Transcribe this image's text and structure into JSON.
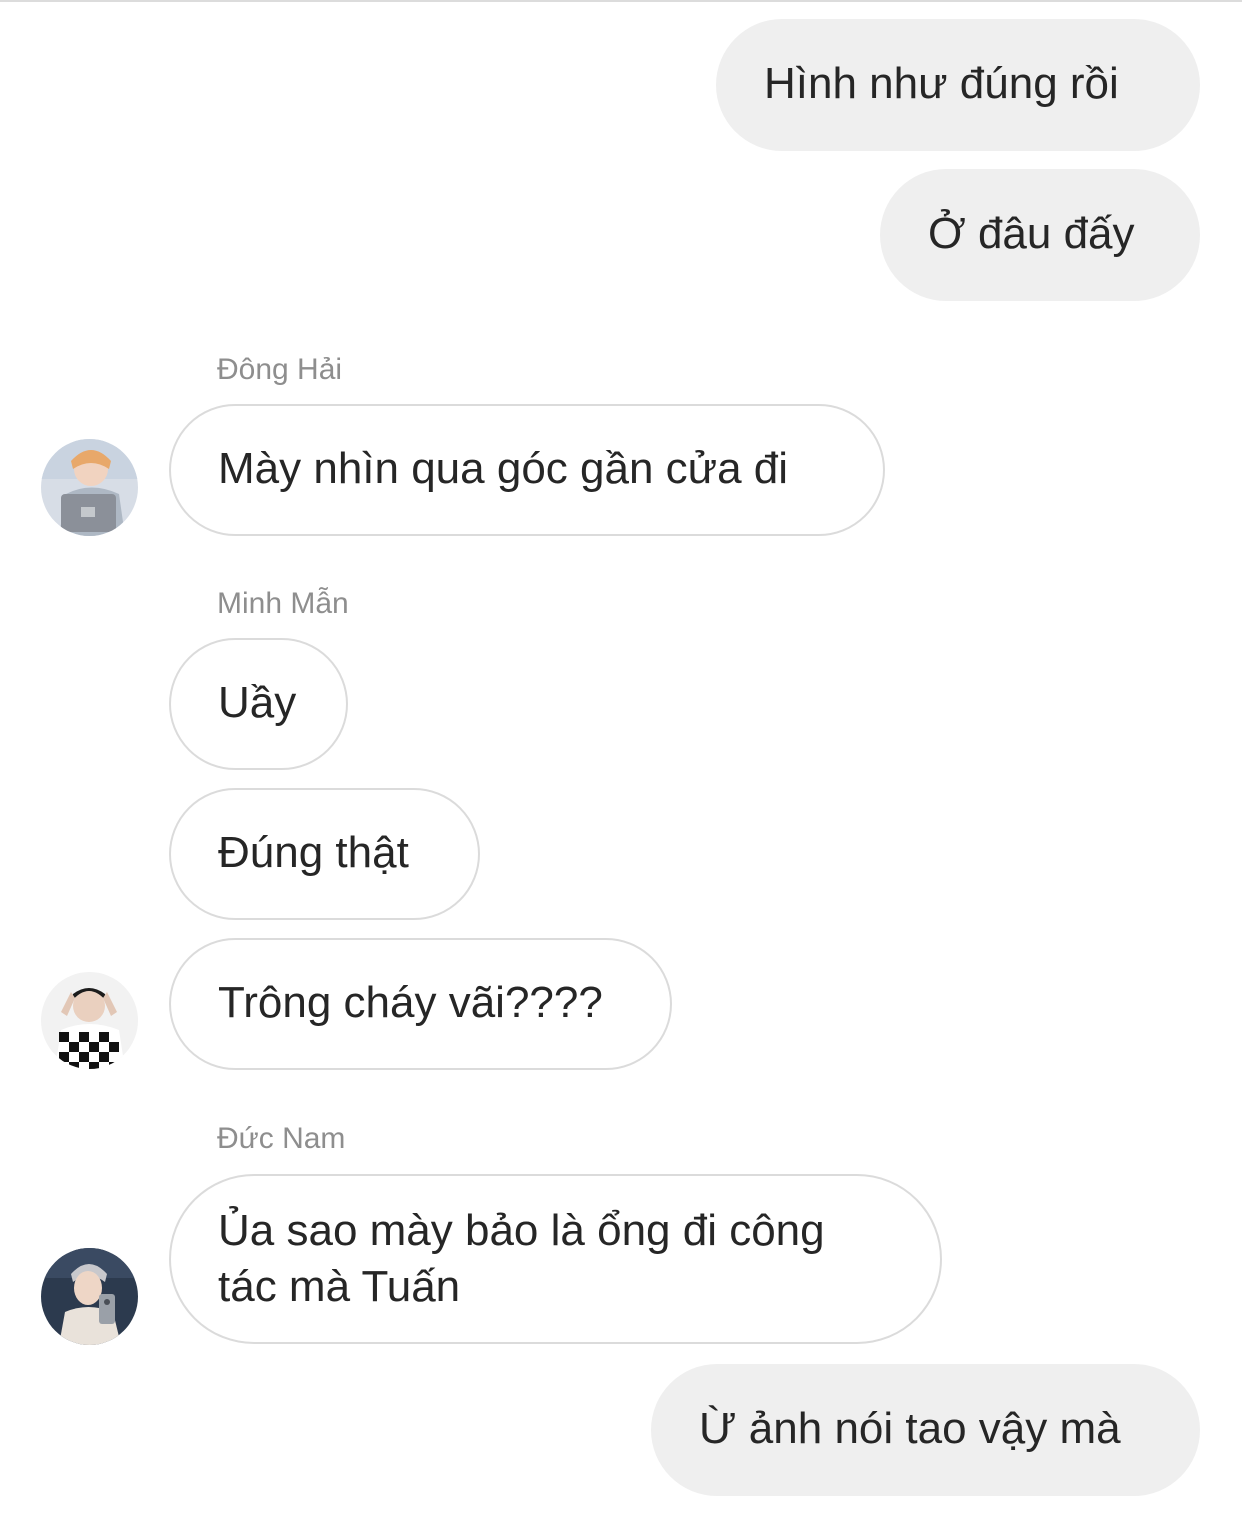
{
  "messages": {
    "m1": "Hình như đúng rồi",
    "m2": "Ở đâu đấy",
    "m3_sender": "Đông Hải",
    "m3": "Mày nhìn qua góc gần cửa đi",
    "m4_sender": "Minh Mẫn",
    "m4": "Uầy",
    "m5": "Đúng thật",
    "m6": "Trông cháy vãi????",
    "m7_sender": "Đức Nam",
    "m7": "Ủa sao mày bảo là ổng đi công tác mà Tuấn",
    "m8": "Ừ ảnh nói tao vậy mà"
  },
  "avatars": {
    "dong_hai": "avatar-photo",
    "minh_man": "avatar-photo",
    "duc_nam": "avatar-photo"
  },
  "colors": {
    "outgoing_bubble": "#efefef",
    "incoming_border": "#dbdbdb",
    "sender_name": "#8e8e8e",
    "text": "#262626"
  }
}
